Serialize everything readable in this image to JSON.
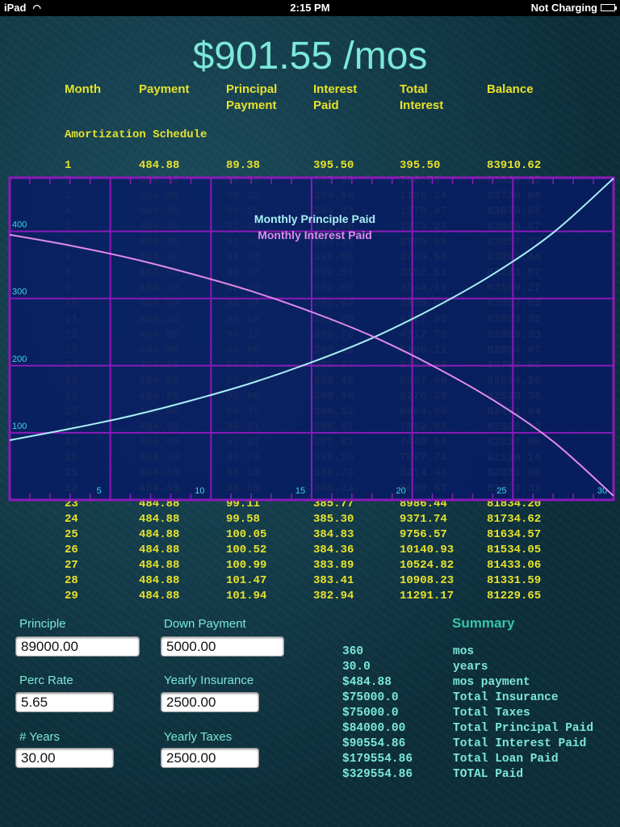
{
  "status_bar": {
    "device": "iPad",
    "time": "2:15 PM",
    "battery_status": "Not Charging",
    "wifi_icon": "wifi-icon",
    "battery_icon": "battery-icon"
  },
  "monthly_total": "$901.55 /mos",
  "table": {
    "headers": [
      [
        "Month",
        ""
      ],
      [
        "Payment",
        ""
      ],
      [
        "Principal",
        "Payment"
      ],
      [
        "Interest",
        "Paid"
      ],
      [
        "Total",
        "Interest"
      ],
      [
        "Balance",
        ""
      ]
    ],
    "section_label": "Amortization Schedule",
    "rows": [
      [
        "1",
        "484.88",
        "89.38",
        "395.50",
        "395.50",
        "83910.62"
      ],
      [
        "2",
        "484.88",
        "89.80",
        "395.08",
        "790.58",
        "83820.82"
      ],
      [
        "3",
        "484.88",
        "90.22",
        "394.66",
        "1185.24",
        "83730.60"
      ],
      [
        "4",
        "484.88",
        "90.65",
        "394.23",
        "1579.47",
        "83639.95"
      ],
      [
        "5",
        "484.88",
        "91.08",
        "393.80",
        "1973.27",
        "83548.87"
      ],
      [
        "6",
        "484.88",
        "91.50",
        "393.38",
        "2366.65",
        "83457.37"
      ],
      [
        "7",
        "484.88",
        "91.93",
        "392.95",
        "2759.60",
        "83365.44"
      ],
      [
        "8",
        "484.88",
        "92.37",
        "392.51",
        "3152.11",
        "83273.07"
      ],
      [
        "9",
        "484.88",
        "92.80",
        "392.08",
        "3544.19",
        "83180.27"
      ],
      [
        "10",
        "484.88",
        "93.24",
        "391.64",
        "3935.83",
        "83087.03"
      ],
      [
        "11",
        "484.88",
        "93.68",
        "391.20",
        "4327.03",
        "82993.35"
      ],
      [
        "12",
        "484.88",
        "94.12",
        "390.76",
        "4717.79",
        "82899.23"
      ],
      [
        "13",
        "484.88",
        "94.56",
        "390.32",
        "5108.11",
        "82804.67"
      ],
      [
        "14",
        "484.88",
        "95.01",
        "389.87",
        "5497.98",
        "82709.66"
      ],
      [
        "15",
        "484.88",
        "95.46",
        "389.42",
        "5887.40",
        "82614.20"
      ],
      [
        "16",
        "484.88",
        "95.90",
        "388.98",
        "6276.38",
        "82518.30"
      ],
      [
        "17",
        "484.88",
        "96.36",
        "388.52",
        "6664.90",
        "82421.94"
      ],
      [
        "18",
        "484.88",
        "96.81",
        "388.07",
        "7052.97",
        "82325.13"
      ],
      [
        "19",
        "484.88",
        "97.27",
        "387.61",
        "7440.58",
        "82227.86"
      ],
      [
        "20",
        "484.88",
        "97.72",
        "387.16",
        "7827.74",
        "82130.14"
      ],
      [
        "21",
        "484.88",
        "98.18",
        "386.70",
        "8214.44",
        "82031.96"
      ],
      [
        "22",
        "484.88",
        "98.65",
        "386.23",
        "8600.67",
        "81933.31"
      ],
      [
        "23",
        "484.88",
        "99.11",
        "385.77",
        "8986.44",
        "81834.20"
      ],
      [
        "24",
        "484.88",
        "99.58",
        "385.30",
        "9371.74",
        "81734.62"
      ],
      [
        "25",
        "484.88",
        "100.05",
        "384.83",
        "9756.57",
        "81634.57"
      ],
      [
        "26",
        "484.88",
        "100.52",
        "384.36",
        "10140.93",
        "81534.05"
      ],
      [
        "27",
        "484.88",
        "100.99",
        "383.89",
        "10524.82",
        "81433.06"
      ],
      [
        "28",
        "484.88",
        "101.47",
        "383.41",
        "10908.23",
        "81331.59"
      ],
      [
        "29",
        "484.88",
        "101.94",
        "382.94",
        "11291.17",
        "81229.65"
      ]
    ]
  },
  "chart_data": {
    "type": "line",
    "title": "",
    "xlabel": "",
    "ylabel": "",
    "xlim": [
      0,
      30
    ],
    "ylim": [
      0,
      480
    ],
    "x_ticks": [
      5,
      10,
      15,
      20,
      25,
      30
    ],
    "y_ticks": [
      100,
      200,
      300,
      400
    ],
    "grid": true,
    "legend_placement": "top-center",
    "series": [
      {
        "name": "Monthly Principle Paid",
        "color": "#a8f0f4",
        "x": [
          0,
          3,
          6,
          9,
          12,
          15,
          18,
          21,
          24,
          27,
          30
        ],
        "values": [
          89,
          106,
          125,
          148,
          174,
          205,
          241,
          285,
          336,
          398,
          479
        ]
      },
      {
        "name": "Monthly Interest Paid",
        "color": "#e08ae8",
        "x": [
          0,
          3,
          6,
          9,
          12,
          15,
          18,
          21,
          24,
          27,
          30
        ],
        "values": [
          395,
          379,
          360,
          337,
          311,
          280,
          244,
          200,
          149,
          87,
          6
        ]
      }
    ]
  },
  "inputs": {
    "principle": {
      "label": "Principle",
      "value": "89000.00"
    },
    "down_payment": {
      "label": "Down Payment",
      "value": "5000.00"
    },
    "perc_rate": {
      "label": "Perc Rate",
      "value": "5.65"
    },
    "yearly_insurance": {
      "label": "Yearly Insurance",
      "value": "2500.00"
    },
    "years": {
      "label": "# Years",
      "value": "30.00"
    },
    "yearly_taxes": {
      "label": "Yearly Taxes",
      "value": "2500.00"
    }
  },
  "summary": {
    "title": "Summary",
    "items": [
      {
        "value": "360",
        "label": "mos"
      },
      {
        "value": "30.0",
        "label": "years"
      },
      {
        "value": "$484.88",
        "label": "mos payment"
      },
      {
        "value": "$75000.0",
        "label": "Total Insurance"
      },
      {
        "value": "$75000.0",
        "label": "Total Taxes"
      },
      {
        "value": "$84000.00",
        "label": "Total Principal Paid"
      },
      {
        "value": "$90554.86",
        "label": "Total Interest Paid"
      },
      {
        "value": "$179554.86",
        "label": "Total Loan Paid"
      },
      {
        "value": "$329554.86",
        "label": "TOTAL Paid"
      }
    ]
  }
}
